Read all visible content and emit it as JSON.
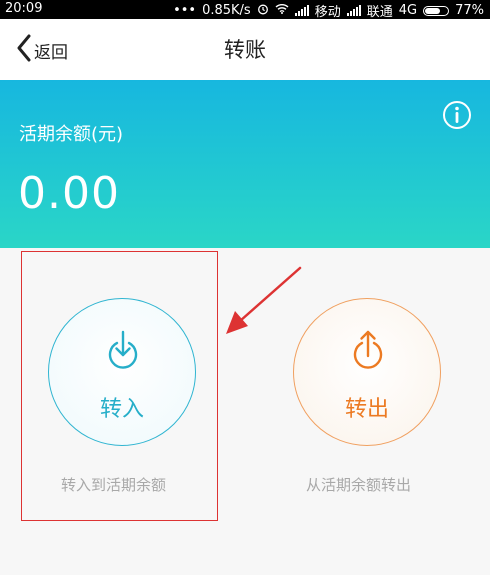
{
  "status_bar": {
    "time": "20:09",
    "dots": "•••",
    "speed": "0.85K/s",
    "carrier1": "移动",
    "carrier2": "联通",
    "network": "4G",
    "battery": "77%",
    "battery_level": 0.77
  },
  "nav": {
    "back_label": "返回",
    "title": "转账"
  },
  "balance": {
    "label": "活期余额(元)",
    "amount": "0.00"
  },
  "actions": {
    "transfer_in": {
      "label": "转入",
      "caption": "转入到活期余额"
    },
    "transfer_out": {
      "label": "转出",
      "caption": "从活期余额转出"
    }
  },
  "colors": {
    "banner_top": "#17b7df",
    "banner_bottom": "#2ad6c7",
    "transfer_in_accent": "#26aec9",
    "transfer_out_accent": "#ec7a22",
    "annotation_red": "#dd3333"
  },
  "icons": {
    "back": "chevron-left-icon",
    "info": "info-icon",
    "transfer_in": "download-arrow-icon",
    "transfer_out": "upload-arrow-icon"
  }
}
